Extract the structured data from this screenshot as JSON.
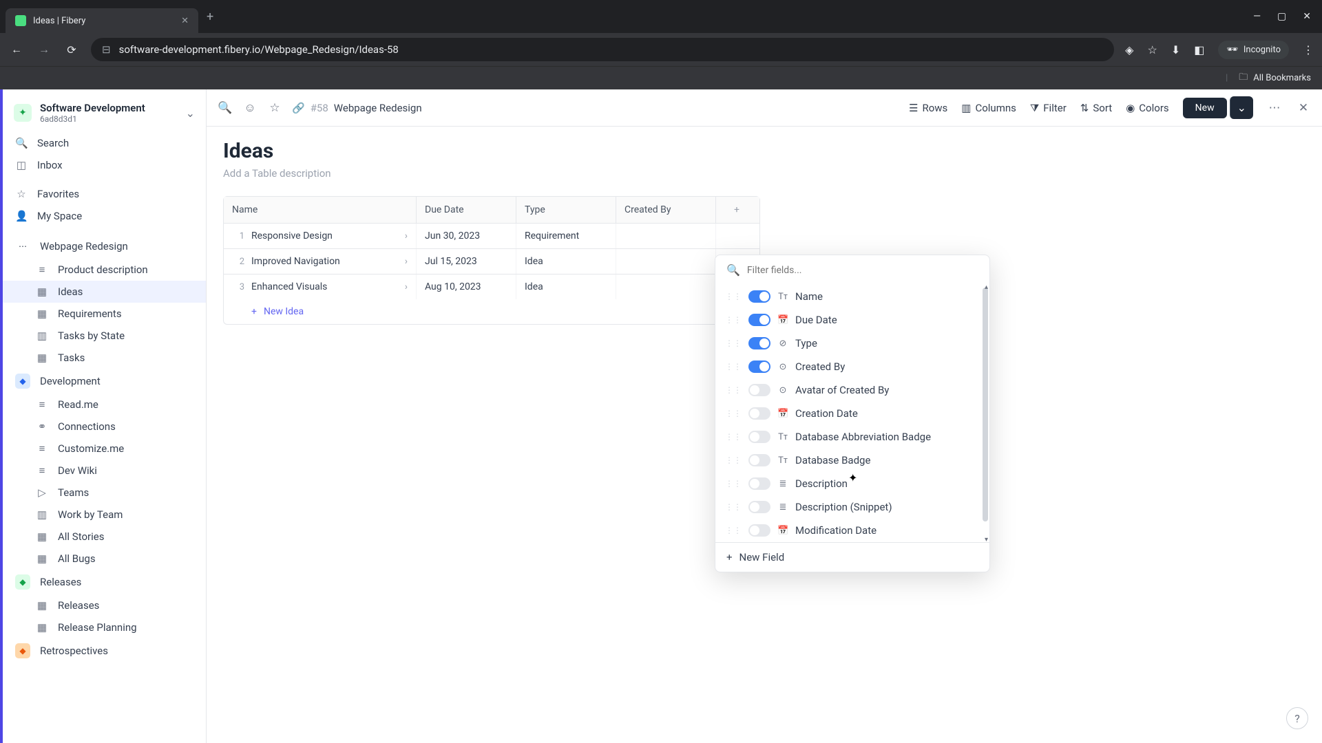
{
  "browser": {
    "tab_title": "Ideas | Fibery",
    "url": "software-development.fibery.io/Webpage_Redesign/Ideas-58",
    "incognito_label": "Incognito",
    "all_bookmarks": "All Bookmarks"
  },
  "workspace": {
    "name": "Software Development",
    "id": "6ad8d3d1"
  },
  "sidebar": {
    "search": "Search",
    "inbox": "Inbox",
    "favorites": "Favorites",
    "my_space": "My Space",
    "spaces": [
      {
        "name": "Webpage Redesign",
        "items": [
          "Product description",
          "Ideas",
          "Requirements",
          "Tasks by State",
          "Tasks"
        ],
        "active_item": "Ideas"
      },
      {
        "name": "Development",
        "items": [
          "Read.me",
          "Connections",
          "Customize.me",
          "Dev Wiki",
          "Teams",
          "Work by Team",
          "All Stories",
          "All Bugs"
        ]
      },
      {
        "name": "Releases",
        "items": [
          "Releases",
          "Release Planning"
        ]
      },
      {
        "name": "Retrospectives",
        "items": []
      }
    ]
  },
  "toolbar": {
    "entity_num": "#58",
    "breadcrumb": "Webpage Redesign",
    "rows": "Rows",
    "columns": "Columns",
    "filter": "Filter",
    "sort": "Sort",
    "colors": "Colors",
    "new": "New"
  },
  "page": {
    "title": "Ideas",
    "description_placeholder": "Add a Table description"
  },
  "table": {
    "columns": [
      "Name",
      "Due Date",
      "Type",
      "Created By"
    ],
    "rows": [
      {
        "num": "1",
        "name": "Responsive Design",
        "date": "Jun 30, 2023",
        "type": "Requirement"
      },
      {
        "num": "2",
        "name": "Improved Navigation",
        "date": "Jul 15, 2023",
        "type": "Idea"
      },
      {
        "num": "3",
        "name": "Enhanced Visuals",
        "date": "Aug 10, 2023",
        "type": "Idea"
      }
    ],
    "new_row": "New Idea"
  },
  "fields_popup": {
    "filter_placeholder": "Filter fields...",
    "fields": [
      {
        "label": "Name",
        "on": true,
        "icon": "text"
      },
      {
        "label": "Due Date",
        "on": true,
        "icon": "date"
      },
      {
        "label": "Type",
        "on": true,
        "icon": "select"
      },
      {
        "label": "Created By",
        "on": true,
        "icon": "user"
      },
      {
        "label": "Avatar of Created By",
        "on": false,
        "icon": "user"
      },
      {
        "label": "Creation Date",
        "on": false,
        "icon": "date"
      },
      {
        "label": "Database Abbreviation Badge",
        "on": false,
        "icon": "text"
      },
      {
        "label": "Database Badge",
        "on": false,
        "icon": "text"
      },
      {
        "label": "Description",
        "on": false,
        "icon": "rich"
      },
      {
        "label": "Description (Snippet)",
        "on": false,
        "icon": "rich"
      },
      {
        "label": "Modification Date",
        "on": false,
        "icon": "date"
      }
    ],
    "new_field": "New Field"
  }
}
